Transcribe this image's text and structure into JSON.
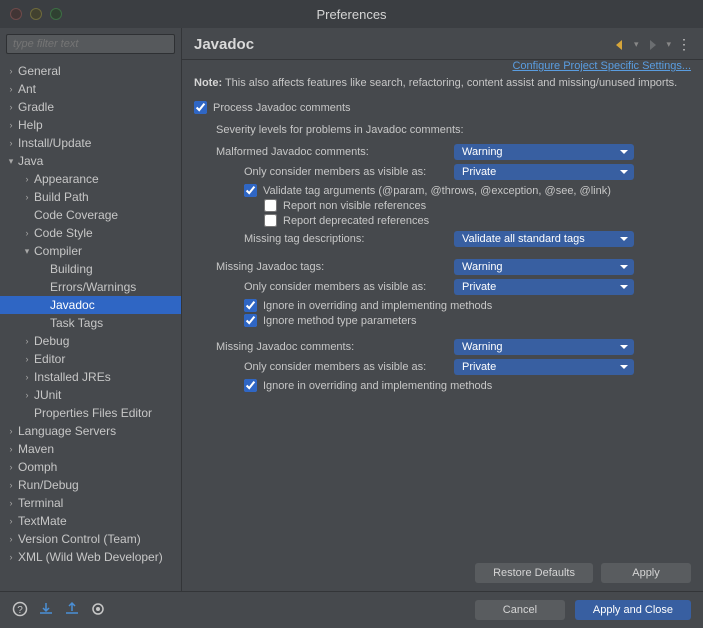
{
  "window": {
    "title": "Preferences"
  },
  "filter": {
    "placeholder": "type filter text"
  },
  "tree": [
    {
      "label": "General",
      "depth": 0,
      "arrow": ">"
    },
    {
      "label": "Ant",
      "depth": 0,
      "arrow": ">"
    },
    {
      "label": "Gradle",
      "depth": 0,
      "arrow": ">"
    },
    {
      "label": "Help",
      "depth": 0,
      "arrow": ">"
    },
    {
      "label": "Install/Update",
      "depth": 0,
      "arrow": ">"
    },
    {
      "label": "Java",
      "depth": 0,
      "arrow": "v"
    },
    {
      "label": "Appearance",
      "depth": 1,
      "arrow": ">"
    },
    {
      "label": "Build Path",
      "depth": 1,
      "arrow": ">"
    },
    {
      "label": "Code Coverage",
      "depth": 1,
      "arrow": ""
    },
    {
      "label": "Code Style",
      "depth": 1,
      "arrow": ">"
    },
    {
      "label": "Compiler",
      "depth": 1,
      "arrow": "v"
    },
    {
      "label": "Building",
      "depth": 2,
      "arrow": ""
    },
    {
      "label": "Errors/Warnings",
      "depth": 2,
      "arrow": ""
    },
    {
      "label": "Javadoc",
      "depth": 2,
      "arrow": "",
      "selected": true
    },
    {
      "label": "Task Tags",
      "depth": 2,
      "arrow": ""
    },
    {
      "label": "Debug",
      "depth": 1,
      "arrow": ">"
    },
    {
      "label": "Editor",
      "depth": 1,
      "arrow": ">"
    },
    {
      "label": "Installed JREs",
      "depth": 1,
      "arrow": ">"
    },
    {
      "label": "JUnit",
      "depth": 1,
      "arrow": ">"
    },
    {
      "label": "Properties Files Editor",
      "depth": 1,
      "arrow": ""
    },
    {
      "label": "Language Servers",
      "depth": 0,
      "arrow": ">"
    },
    {
      "label": "Maven",
      "depth": 0,
      "arrow": ">"
    },
    {
      "label": "Oomph",
      "depth": 0,
      "arrow": ">"
    },
    {
      "label": "Run/Debug",
      "depth": 0,
      "arrow": ">"
    },
    {
      "label": "Terminal",
      "depth": 0,
      "arrow": ">"
    },
    {
      "label": "TextMate",
      "depth": 0,
      "arrow": ">"
    },
    {
      "label": "Version Control (Team)",
      "depth": 0,
      "arrow": ">"
    },
    {
      "label": "XML (Wild Web Developer)",
      "depth": 0,
      "arrow": ">"
    }
  ],
  "page": {
    "title": "Javadoc",
    "configure_link": "Configure Project Specific Settings...",
    "note_bold": "Note:",
    "note_text": " This also affects features like search, refactoring, content assist and missing/unused imports.",
    "process_label": "Process Javadoc comments",
    "severity_heading": "Severity levels for problems in Javadoc comments:",
    "malformed": {
      "label": "Malformed Javadoc comments:",
      "value": "Warning",
      "visibility_label": "Only consider members as visible as:",
      "visibility_value": "Private",
      "validate_tag": "Validate tag arguments (@param, @throws, @exception, @see, @link)",
      "report_non_visible": "Report non visible references",
      "report_deprecated": "Report deprecated references",
      "missing_desc_label": "Missing tag descriptions:",
      "missing_desc_value": "Validate all standard tags"
    },
    "missing_tags": {
      "label": "Missing Javadoc tags:",
      "value": "Warning",
      "visibility_label": "Only consider members as visible as:",
      "visibility_value": "Private",
      "ignore_override": "Ignore in overriding and implementing methods",
      "ignore_params": "Ignore method type parameters"
    },
    "missing_comments": {
      "label": "Missing Javadoc comments:",
      "value": "Warning",
      "visibility_label": "Only consider members as visible as:",
      "visibility_value": "Private",
      "ignore_override": "Ignore in overriding and implementing methods"
    },
    "restore": "Restore Defaults",
    "apply": "Apply"
  },
  "footer": {
    "cancel": "Cancel",
    "apply_close": "Apply and Close"
  }
}
